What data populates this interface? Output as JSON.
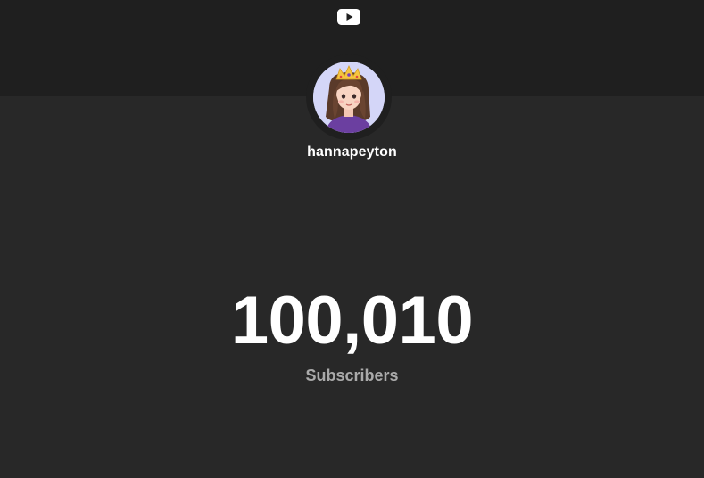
{
  "header": {
    "logo_icon": "youtube-play-icon",
    "band_color": "#1f1f1f"
  },
  "channel": {
    "avatar_icon": "channel-avatar-cartoon-girl-with-crown",
    "name": "hannapeyton"
  },
  "stats": {
    "subscriber_count": "100,010",
    "subscriber_label": "Subscribers"
  },
  "colors": {
    "background": "#282828",
    "text_primary": "#ffffff",
    "text_secondary": "#aaaaaa"
  }
}
